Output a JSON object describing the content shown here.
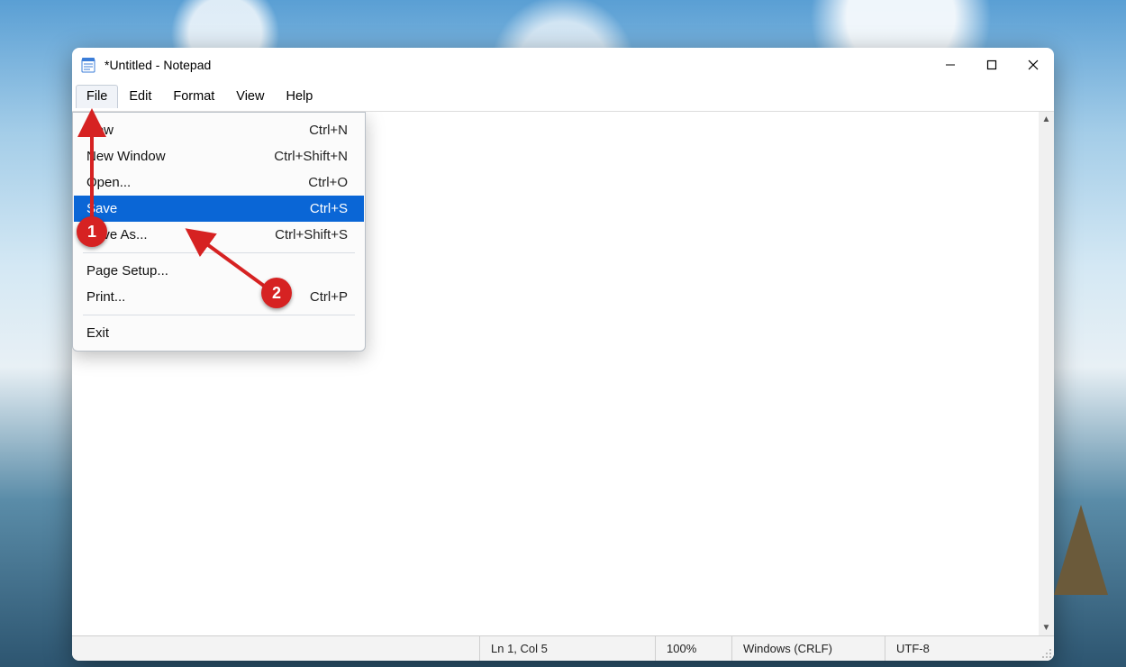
{
  "window": {
    "title": "*Untitled - Notepad"
  },
  "menubar": {
    "items": [
      "File",
      "Edit",
      "Format",
      "View",
      "Help"
    ],
    "active_index": 0
  },
  "dropdown": {
    "title": "File",
    "items": [
      {
        "label": "New",
        "shortcut": "Ctrl+N",
        "highlighted": false
      },
      {
        "label": "New Window",
        "shortcut": "Ctrl+Shift+N",
        "highlighted": false
      },
      {
        "label": "Open...",
        "shortcut": "Ctrl+O",
        "highlighted": false
      },
      {
        "label": "Save",
        "shortcut": "Ctrl+S",
        "highlighted": true
      },
      {
        "label": "Save As...",
        "shortcut": "Ctrl+Shift+S",
        "highlighted": false
      },
      {
        "type": "separator"
      },
      {
        "label": "Page Setup...",
        "shortcut": "",
        "highlighted": false
      },
      {
        "label": "Print...",
        "shortcut": "Ctrl+P",
        "highlighted": false
      },
      {
        "type": "separator"
      },
      {
        "label": "Exit",
        "shortcut": "",
        "highlighted": false
      }
    ]
  },
  "statusbar": {
    "position": "Ln 1, Col 5",
    "zoom": "100%",
    "line_ending": "Windows (CRLF)",
    "encoding": "UTF-8"
  },
  "annotations": {
    "badge1": "1",
    "badge2": "2"
  },
  "colors": {
    "highlight": "#0a66d6",
    "annotation": "#d62222"
  }
}
